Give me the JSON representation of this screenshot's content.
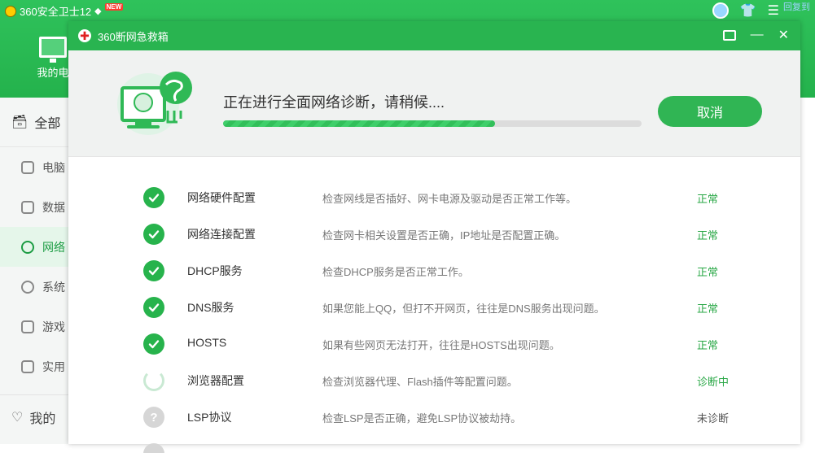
{
  "app": {
    "title": "360安全卫士12",
    "new_badge": "NEW",
    "mypc_label": "我的电",
    "ad_text": "回复到",
    "sidebar": {
      "head": "全部",
      "items": [
        {
          "label": "电脑"
        },
        {
          "label": "数据"
        },
        {
          "label": "网络"
        },
        {
          "label": "系统"
        },
        {
          "label": "游戏"
        },
        {
          "label": "实用"
        }
      ],
      "footer": "我的"
    }
  },
  "dialog": {
    "title": "360断网急救箱",
    "status_text": "正在进行全面网络诊断，请稍候....",
    "progress": 0.65,
    "cancel_label": "取消",
    "items": [
      {
        "name": "网络硬件配置",
        "desc": "检查网线是否插好、网卡电源及驱动是否正常工作等。",
        "status": "正常",
        "state": "ok"
      },
      {
        "name": "网络连接配置",
        "desc": "检查网卡相关设置是否正确，IP地址是否配置正确。",
        "status": "正常",
        "state": "ok"
      },
      {
        "name": "DHCP服务",
        "desc": "检查DHCP服务是否正常工作。",
        "status": "正常",
        "state": "ok"
      },
      {
        "name": "DNS服务",
        "desc": "如果您能上QQ，但打不开网页，往往是DNS服务出现问题。",
        "status": "正常",
        "state": "ok"
      },
      {
        "name": "HOSTS",
        "desc": "如果有些网页无法打开，往往是HOSTS出现问题。",
        "status": "正常",
        "state": "ok"
      },
      {
        "name": "浏览器配置",
        "desc": "检查浏览器代理、Flash插件等配置问题。",
        "status": "诊断中",
        "state": "running"
      },
      {
        "name": "LSP协议",
        "desc": "检查LSP是否正确，避免LSP协议被劫持。",
        "status": "未诊断",
        "state": "pending"
      }
    ]
  },
  "colors": {
    "brand_green": "#29b450",
    "ok_green": "#27b34c",
    "status_ok_text": "#28a745"
  }
}
